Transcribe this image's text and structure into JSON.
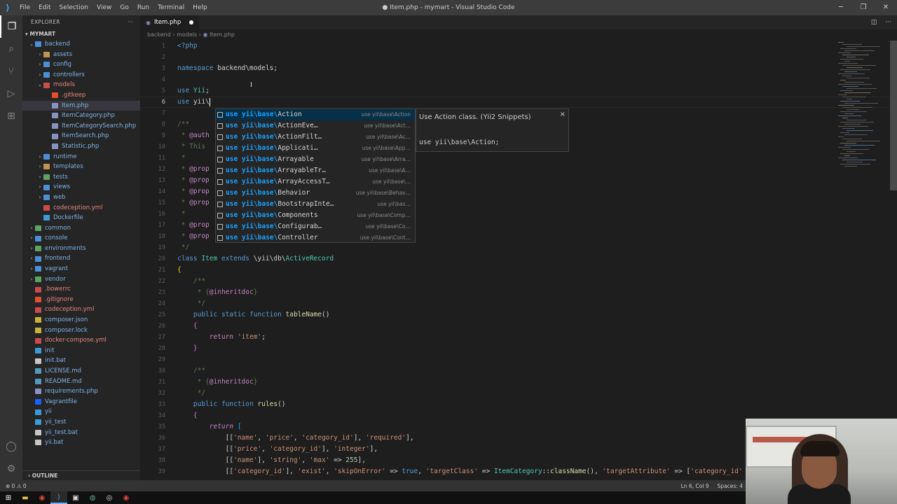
{
  "window": {
    "title": "● Item.php - mymart - Visual Studio Code",
    "menu": [
      "File",
      "Edit",
      "Selection",
      "View",
      "Go",
      "Run",
      "Terminal",
      "Help"
    ]
  },
  "explorer": {
    "header": "EXPLORER",
    "more": "···",
    "root": "MYMART",
    "items": [
      {
        "label": "backend",
        "indent": 1,
        "type": "folder-open",
        "color": "blue"
      },
      {
        "label": "assets",
        "indent": 2,
        "type": "folder",
        "color": "orange"
      },
      {
        "label": "config",
        "indent": 2,
        "type": "folder",
        "color": "blue"
      },
      {
        "label": "controllers",
        "indent": 2,
        "type": "folder",
        "color": "blue"
      },
      {
        "label": "models",
        "indent": 2,
        "type": "folder-open",
        "color": "red"
      },
      {
        "label": ".gitkeep",
        "indent": 3,
        "type": "git"
      },
      {
        "label": "Item.php",
        "indent": 3,
        "type": "php",
        "selected": true
      },
      {
        "label": "ItemCategory.php",
        "indent": 3,
        "type": "php"
      },
      {
        "label": "ItemCategorySearch.php",
        "indent": 3,
        "type": "php"
      },
      {
        "label": "ItemSearch.php",
        "indent": 3,
        "type": "php"
      },
      {
        "label": "Statistic.php",
        "indent": 3,
        "type": "php"
      },
      {
        "label": "runtime",
        "indent": 2,
        "type": "folder",
        "color": "blue"
      },
      {
        "label": "templates",
        "indent": 2,
        "type": "folder",
        "color": "orange"
      },
      {
        "label": "tests",
        "indent": 2,
        "type": "folder",
        "color": "green"
      },
      {
        "label": "views",
        "indent": 2,
        "type": "folder",
        "color": "blue"
      },
      {
        "label": "web",
        "indent": 2,
        "type": "folder",
        "color": "blue"
      },
      {
        "label": "codeception.yml",
        "indent": 2,
        "type": "yml"
      },
      {
        "label": "Dockerfile",
        "indent": 2,
        "type": "doc"
      },
      {
        "label": "common",
        "indent": 1,
        "type": "folder",
        "color": "green"
      },
      {
        "label": "console",
        "indent": 1,
        "type": "folder",
        "color": "blue"
      },
      {
        "label": "environments",
        "indent": 1,
        "type": "folder",
        "color": "green"
      },
      {
        "label": "frontend",
        "indent": 1,
        "type": "folder",
        "color": "blue"
      },
      {
        "label": "vagrant",
        "indent": 1,
        "type": "folder",
        "color": "blue"
      },
      {
        "label": "vendor",
        "indent": 1,
        "type": "folder",
        "color": "green"
      },
      {
        "label": ".bowerrc",
        "indent": 1,
        "type": "yml"
      },
      {
        "label": ".gitignore",
        "indent": 1,
        "type": "git"
      },
      {
        "label": "codeception.yml",
        "indent": 1,
        "type": "yml"
      },
      {
        "label": "composer.json",
        "indent": 1,
        "type": "json"
      },
      {
        "label": "composer.lock",
        "indent": 1,
        "type": "json"
      },
      {
        "label": "docker-compose.yml",
        "indent": 1,
        "type": "yml"
      },
      {
        "label": "init",
        "indent": 1,
        "type": "doc"
      },
      {
        "label": "init.bat",
        "indent": 1,
        "type": "bat"
      },
      {
        "label": "LICENSE.md",
        "indent": 1,
        "type": "md"
      },
      {
        "label": "README.md",
        "indent": 1,
        "type": "md"
      },
      {
        "label": "requirements.php",
        "indent": 1,
        "type": "php"
      },
      {
        "label": "Vagrantfile",
        "indent": 1,
        "type": "vg"
      },
      {
        "label": "yii",
        "indent": 1,
        "type": "doc"
      },
      {
        "label": "yii_test",
        "indent": 1,
        "type": "doc"
      },
      {
        "label": "yii_test.bat",
        "indent": 1,
        "type": "bat"
      },
      {
        "label": "yii.bat",
        "indent": 1,
        "type": "bat"
      }
    ],
    "outline": "OUTLINE"
  },
  "tab": {
    "label": "Item.php"
  },
  "breadcrumb": {
    "a": "backend",
    "b": "models",
    "c": "Item.php"
  },
  "lines": [
    {
      "n": "1",
      "html": "<span class='tag'>&lt;?php</span>"
    },
    {
      "n": "2",
      "html": ""
    },
    {
      "n": "3",
      "html": "<span class='kw'>namespace</span> <span class='ns'>backend\\models</span>;"
    },
    {
      "n": "4",
      "html": ""
    },
    {
      "n": "5",
      "html": "<span class='kw'>use</span> <span class='cls'>Yii</span>;"
    },
    {
      "n": "6",
      "html": "<span class='kw'>use</span> yii\\<span class='cursor'></span>",
      "cur": true
    },
    {
      "n": "7",
      "html": ""
    },
    {
      "n": "8",
      "html": "<span class='doc'>/**</span>"
    },
    {
      "n": "9",
      "html": "<span class='doc'> * </span><span class='k2'>@auth</span>"
    },
    {
      "n": "10",
      "html": "<span class='doc'> * This</span>"
    },
    {
      "n": "11",
      "html": "<span class='doc'> *</span>"
    },
    {
      "n": "12",
      "html": "<span class='doc'> * </span><span class='k2'>@prop</span>"
    },
    {
      "n": "13",
      "html": "<span class='doc'> * </span><span class='k2'>@prop</span>"
    },
    {
      "n": "14",
      "html": "<span class='doc'> * </span><span class='k2'>@prop</span>"
    },
    {
      "n": "15",
      "html": "<span class='doc'> * </span><span class='k2'>@prop</span>"
    },
    {
      "n": "16",
      "html": "<span class='doc'> *</span>"
    },
    {
      "n": "17",
      "html": "<span class='doc'> * </span><span class='k2'>@prop</span>"
    },
    {
      "n": "18",
      "html": "<span class='doc'> * </span><span class='k2'>@prop</span>"
    },
    {
      "n": "19",
      "html": "<span class='doc'> */</span>"
    },
    {
      "n": "20",
      "html": "<span class='kw'>class</span> <span class='cls'>Item</span> <span class='kw'>extends</span> \\<span class='ns'>yii\\db\\</span><span class='cls'>ActiveRecord</span>"
    },
    {
      "n": "21",
      "html": "<span style='color:#ffd700'>{</span>"
    },
    {
      "n": "22",
      "html": "    <span class='doc'>/**</span>"
    },
    {
      "n": "23",
      "html": "    <span class='doc'> * {</span><span class='k2'>@inheritdoc</span><span class='doc'>}</span>"
    },
    {
      "n": "24",
      "html": "    <span class='doc'> */</span>"
    },
    {
      "n": "25",
      "html": "    <span class='kw'>public</span> <span class='kw'>static</span> <span class='kw'>function</span> <span class='fn'>tableName</span>()"
    },
    {
      "n": "26",
      "html": "    <span style='color:#da70d6'>{</span>"
    },
    {
      "n": "27",
      "html": "        <span class='k2'>return</span> <span class='str'>'item'</span>;"
    },
    {
      "n": "28",
      "html": "    <span style='color:#da70d6'>}</span>"
    },
    {
      "n": "29",
      "html": ""
    },
    {
      "n": "30",
      "html": "    <span class='doc'>/**</span>"
    },
    {
      "n": "31",
      "html": "    <span class='doc'> * {</span><span class='k2'>@inheritdoc</span><span class='doc'>}</span>"
    },
    {
      "n": "32",
      "html": "    <span class='doc'> */</span>"
    },
    {
      "n": "33",
      "html": "    <span class='kw'>public</span> <span class='kw'>function</span> <span class='fn'>rules</span>()"
    },
    {
      "n": "34",
      "html": "    <span style='color:#da70d6'>{</span>"
    },
    {
      "n": "35",
      "html": "        <span class='k2'><i>return</i></span> <span style='color:#179fff'>[</span>"
    },
    {
      "n": "36",
      "html": "            [[<span class='str'>'name'</span>, <span class='str'>'price'</span>, <span class='str'>'category_id'</span>], <span class='str'>'required'</span>],"
    },
    {
      "n": "37",
      "html": "            [[<span class='str'>'price'</span>, <span class='str'>'category_id'</span>], <span class='str'>'integer'</span>],"
    },
    {
      "n": "38",
      "html": "            [[<span class='str'>'name'</span>], <span class='str'>'string'</span>, <span class='str'>'max'</span> =&gt; <span class='num'>255</span>],"
    },
    {
      "n": "39",
      "html": "            [[<span class='str'>'category_id'</span>], <span class='str'>'exist'</span>, <span class='str'>'skipOnError'</span> =&gt; <span class='kw'>true</span>, <span class='str'>'targetClass'</span> =&gt; <span class='cls'>ItemCategory</span>::<span class='fn'>className</span>(), <span class='str'>'targetAttribute'</span> =&gt; [<span class='str'>'category_id'</span> =&gt;"
    }
  ],
  "suggestions": [
    {
      "rest": "Action",
      "detail": "use yii\\base\\Action"
    },
    {
      "rest": "ActionEve…",
      "detail": "use yii\\base\\Act…"
    },
    {
      "rest": "ActionFilt…",
      "detail": "use yii\\base\\Ac…"
    },
    {
      "rest": "Applicati…",
      "detail": "use yii\\base\\App…"
    },
    {
      "rest": "Arrayable",
      "detail": "use yii\\base\\Arra…"
    },
    {
      "rest": "ArrayableTr…",
      "detail": "use yii\\base\\A…"
    },
    {
      "rest": "ArrayAccessT…",
      "detail": "use yii\\base\\…"
    },
    {
      "rest": "Behavior",
      "detail": "use yii\\base\\Behav…"
    },
    {
      "rest": "BootstrapInte…",
      "detail": "use yii\\bas…"
    },
    {
      "rest": "Components",
      "detail": "use yii\\base\\Comp…"
    },
    {
      "rest": "Configurab…",
      "detail": "use yii\\base\\Co…"
    },
    {
      "rest": "Controller",
      "detail": "use yii\\base\\Cont…"
    }
  ],
  "suggestion_prefix": "use yii\\base\\",
  "suggestion_doc": {
    "title": "Use Action class. (Yii2 Snippets)",
    "close": "×",
    "code": "use yii\\base\\Action;"
  },
  "status": {
    "left": "⊗ 0 ⚠ 0",
    "position": "Ln 6, Col 9",
    "spaces": "Spaces: 4"
  }
}
